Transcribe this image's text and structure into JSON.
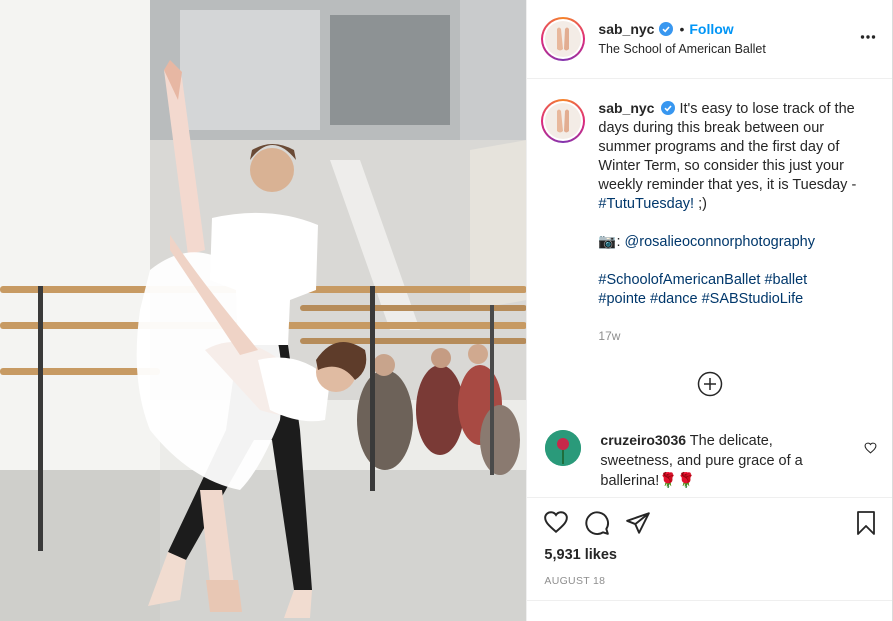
{
  "post": {
    "username": "sab_nyc",
    "separator": "•",
    "follow_label": "Follow",
    "subtitle": "The School of American Ballet",
    "more_icon": "more-horizontal-icon",
    "verified_color": "#3897f0"
  },
  "caption": {
    "username": "sab_nyc",
    "text": "It's easy to lose track of the days during this break between our summer programs and the first day of Winter Term, so consider this just your weekly reminder that yes, it is Tuesday -",
    "tag1": "#TutuTuesday!",
    "tail": ";)",
    "camera_emoji": "📷:",
    "mention": "@rosalieoconnorphotography",
    "hashtags_line1": "#SchoolofAmericanBallet #ballet",
    "hashtags_line2": "#pointe #dance #SABStudioLife",
    "time": "17w"
  },
  "comment": {
    "username": "cruzeiro3036",
    "text": "The delicate, sweetness, and pure grace of a ballerina!🌹🌹"
  },
  "actions": {
    "likes": "5,931 likes",
    "date": "AUGUST 18"
  },
  "colors": {
    "link": "#00376b",
    "follow": "#0095f6",
    "muted": "#8e8e8e"
  }
}
